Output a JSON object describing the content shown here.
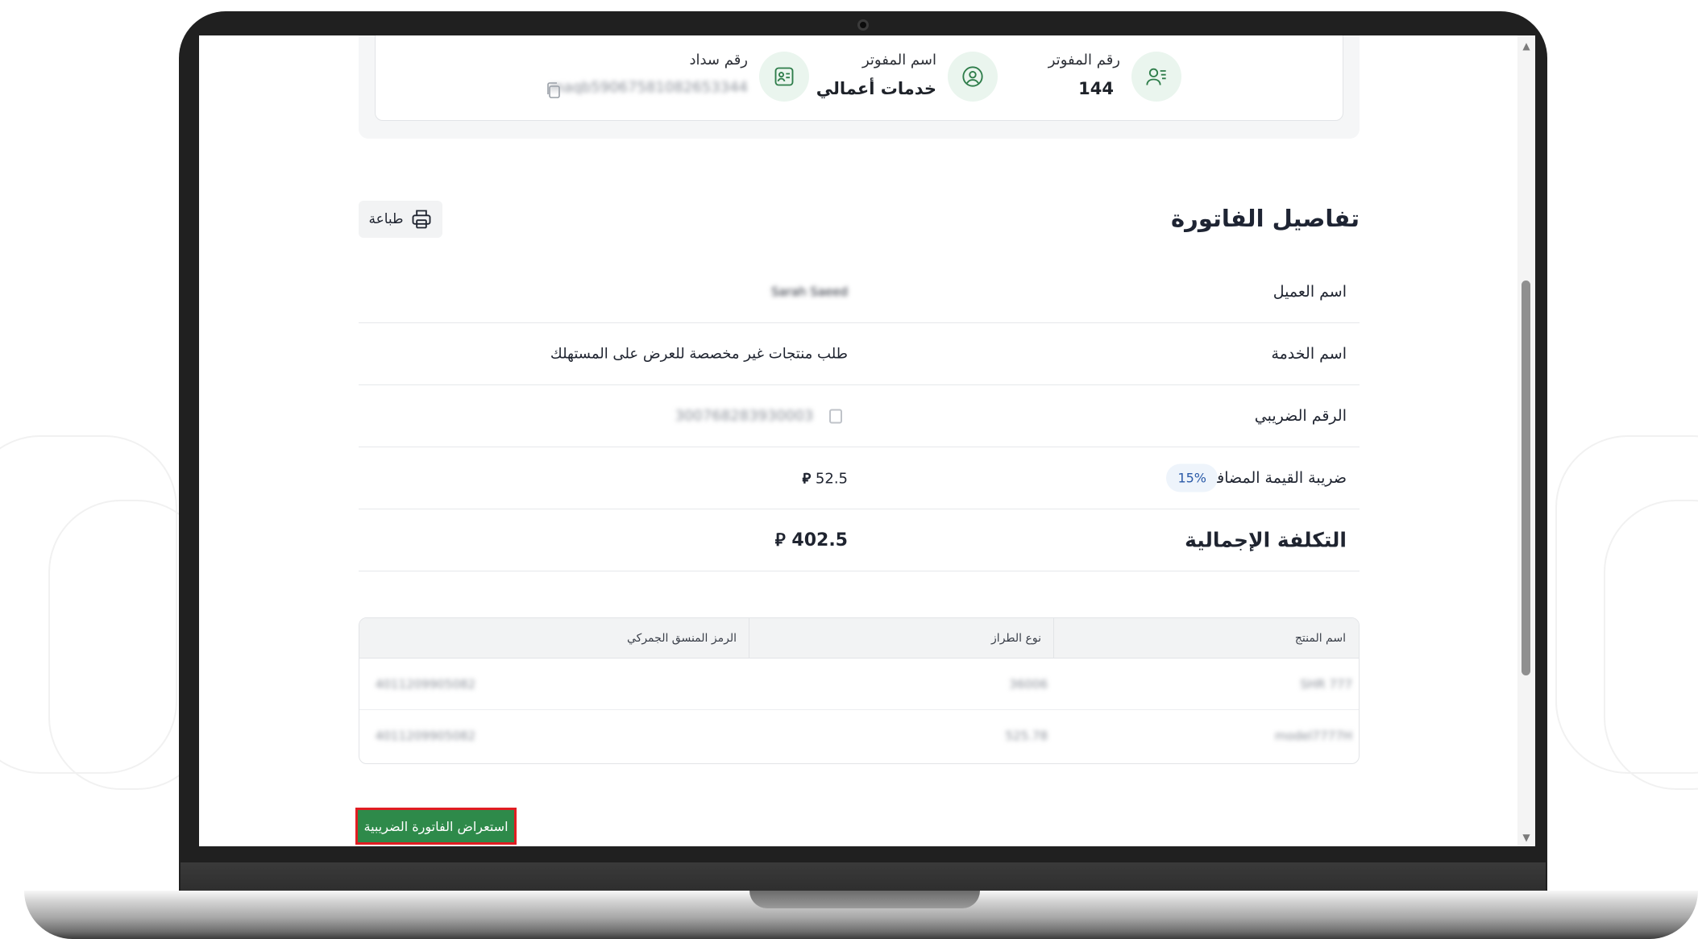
{
  "billing_info": {
    "biller_number_label": "رقم المفوتر",
    "biller_number_value": "144",
    "biller_name_label": "اسم المفوتر",
    "biller_name_value": "خدمات أعمالي",
    "sadad_number_label": "رقم سداد",
    "sadad_number_value": "maqb59067581082653344"
  },
  "invoice": {
    "title": "تفاصيل الفاتورة",
    "print_label": "طباعة",
    "customer_name_label": "اسم العميل",
    "customer_name_value": "Sarah Saeed",
    "service_name_label": "اسم الخدمة",
    "service_name_value": "طلب منتجات غير مخصصة للعرض على المستهلك",
    "tax_number_label": "الرقم الضريبي",
    "tax_number_value": "300768283930003",
    "vat_label": "ضريبة القيمة المضافة",
    "vat_rate": "15%",
    "vat_amount": "52.5",
    "total_label": "التكلفة الإجمالية",
    "total_amount": "402.5",
    "currency_symbol": "⃁"
  },
  "products_table": {
    "headers": {
      "product_name": "اسم المنتج",
      "model_type": "نوع الطراز",
      "hs_code": "الرمز المنسق الجمركي"
    },
    "rows": [
      {
        "product_name": "SHR 777",
        "model_type": "36006",
        "hs_code": "4011209905082"
      },
      {
        "product_name": "model7777H",
        "model_type": "525.78",
        "hs_code": "4011209905082"
      }
    ]
  },
  "actions": {
    "view_tax_invoice": "استعراض الفاتورة الضريبية"
  },
  "colors": {
    "primary_green": "#2e8a4a",
    "highlight_red": "#e11d22",
    "icon_bg": "#eaf5ee"
  },
  "icons": {
    "biller_number": "user-lines-icon",
    "biller_name": "user-circle-icon",
    "sadad_number": "id-card-icon",
    "copy": "copy-icon",
    "print": "printer-icon"
  }
}
